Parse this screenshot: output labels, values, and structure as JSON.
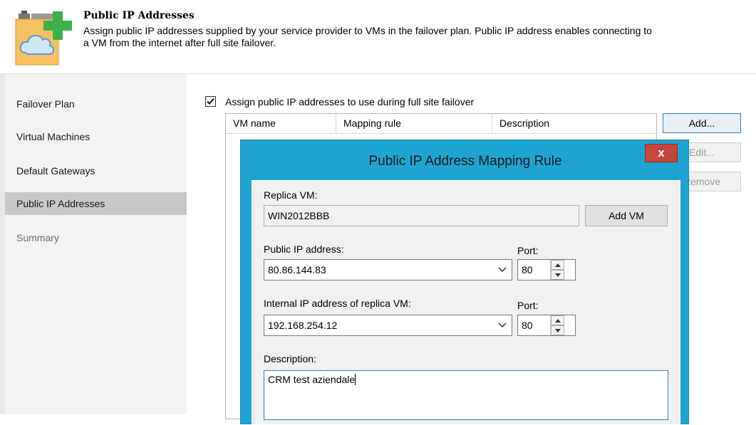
{
  "header": {
    "title": "Public IP Addresses",
    "description_line1": "Assign public IP addresses supplied by your service provider to VMs in the failover plan. Public IP address enables connecting to",
    "description_line2": "a VM from the internet after full site failover."
  },
  "sidebar": {
    "items": [
      {
        "label": "Failover Plan"
      },
      {
        "label": "Virtual Machines"
      },
      {
        "label": "Default Gateways"
      },
      {
        "label": "Public IP Addresses",
        "selected": true
      },
      {
        "label": "Summary",
        "disabled": true
      }
    ]
  },
  "main": {
    "checkbox_label": "Assign public IP addresses to use during full site failover",
    "checked": true,
    "columns": [
      "VM name",
      "Mapping rule",
      "Description"
    ],
    "buttons": {
      "add": "Add...",
      "edit": "Edit...",
      "remove": "Remove"
    }
  },
  "dialog": {
    "title": "Public IP Address Mapping Rule",
    "close": "x",
    "replica_label": "Replica VM:",
    "replica_value": "WIN2012BBB",
    "add_vm": "Add VM",
    "public_ip_label": "Public IP address:",
    "public_ip_value": "80.86.144.83",
    "port_label": "Port:",
    "public_port": "80",
    "internal_ip_label": "Internal IP address of replica VM:",
    "internal_ip_value": "192.168.254.12",
    "internal_port_label": "Port:",
    "internal_port": "80",
    "description_label": "Description:",
    "description_value": "CRM test aziendale"
  },
  "colors": {
    "dialog_frame": "#1fa3d1",
    "close_button": "#c7463b",
    "selected_item": "#c8c8c8"
  }
}
